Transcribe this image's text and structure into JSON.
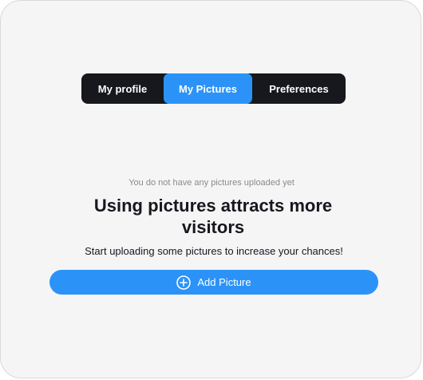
{
  "tabs": {
    "profile": "My profile",
    "pictures": "My Pictures",
    "preferences": "Preferences",
    "active": "My Pictures"
  },
  "empty_state": {
    "note": "You do not have any pictures uploaded yet",
    "headline": "Using pictures attracts more visitors",
    "subtext": "Start uploading some pictures to increase your chances!",
    "button_label": "Add Picture",
    "button_icon": "plus-circle-icon"
  },
  "colors": {
    "accent": "#2b93f7",
    "tab_bar": "#16181d",
    "background": "#f5f5f6"
  }
}
